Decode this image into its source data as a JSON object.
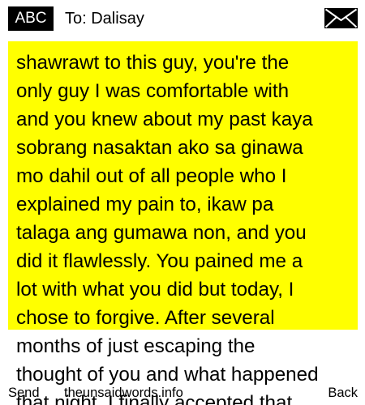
{
  "header": {
    "input_mode": "ABC",
    "recipient": "To: Dalisay",
    "message_icon": "envelope-icon"
  },
  "message": {
    "text": "shawrawt to this guy, you're the\nonly guy I was comfortable with\nand you knew about my past kaya\nsobrang nasaktan ako sa ginawa\nmo dahil out of all people who I\nexplained my pain to, ikaw pa\ntalaga ang gumawa non, and you\ndid it flawlessly. You pained me a\nlot with what you did but today, I\nchose to forgive. After several\nmonths of just escaping the\nthought of you and what happened\nthat night, I finally accepted that",
    "highlight_color": "#ffff00"
  },
  "softkeys": {
    "left": "Send",
    "center": "theunsaidwords.info",
    "right": "Back"
  },
  "colors": {
    "background": "#ffffff",
    "text": "#000000",
    "badge_background": "#000000",
    "badge_text": "#ffffff"
  }
}
